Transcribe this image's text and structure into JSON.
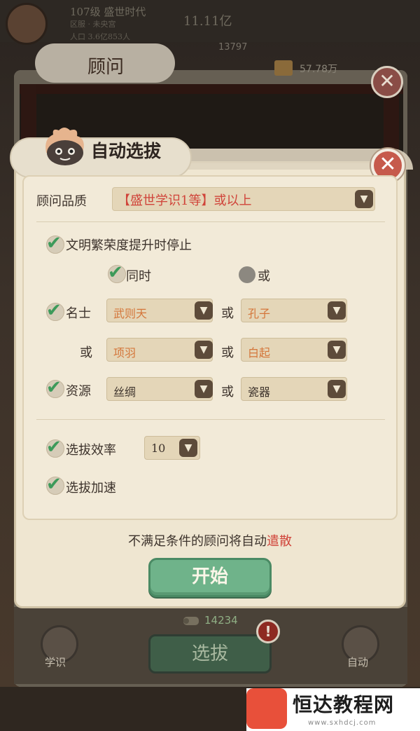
{
  "topbar": {
    "player_line": "107级 盛世时代",
    "sub_line": "区服 · 未央宫",
    "pop_line": "人口 3.6亿853人",
    "coin": "11.11亿",
    "power": "13797",
    "resource": "57.78万"
  },
  "advisor_panel": {
    "title": "顾问"
  },
  "dialog": {
    "title": "自动选拔",
    "close_symbol": "✕",
    "quality_label": "顾问品质",
    "quality_value": "【盛世学识1等】或以上",
    "stop_label": "文明繁荣度提升时停止",
    "mode_same": "同时",
    "mode_or": "或",
    "celebrity_label": "名士",
    "celebrity_a": "武则天",
    "celebrity_b": "孔子",
    "celebrity_c": "项羽",
    "celebrity_d": "白起",
    "resource_label": "资源",
    "resource_a": "丝绸",
    "resource_b": "瓷器",
    "or_word": "或",
    "efficiency_label": "选拔效率",
    "efficiency_value": "10",
    "speedup_label": "选拔加速",
    "notice_main": "不满足条件的顾问将自动",
    "notice_red": "遣散",
    "start_label": "开始"
  },
  "bottom": {
    "cost": "14234",
    "select_label": "选拔",
    "alert": "!",
    "left_btn_label": "学识",
    "right_btn_label": "自动"
  },
  "watermark": {
    "text": "恒达教程网",
    "url": "www.sxhdcj.com"
  },
  "colors": {
    "accent_green": "#6fb38a",
    "warning_red": "#d0443a",
    "option_orange": "#d4763a",
    "panel_bg": "#efe6d1"
  }
}
